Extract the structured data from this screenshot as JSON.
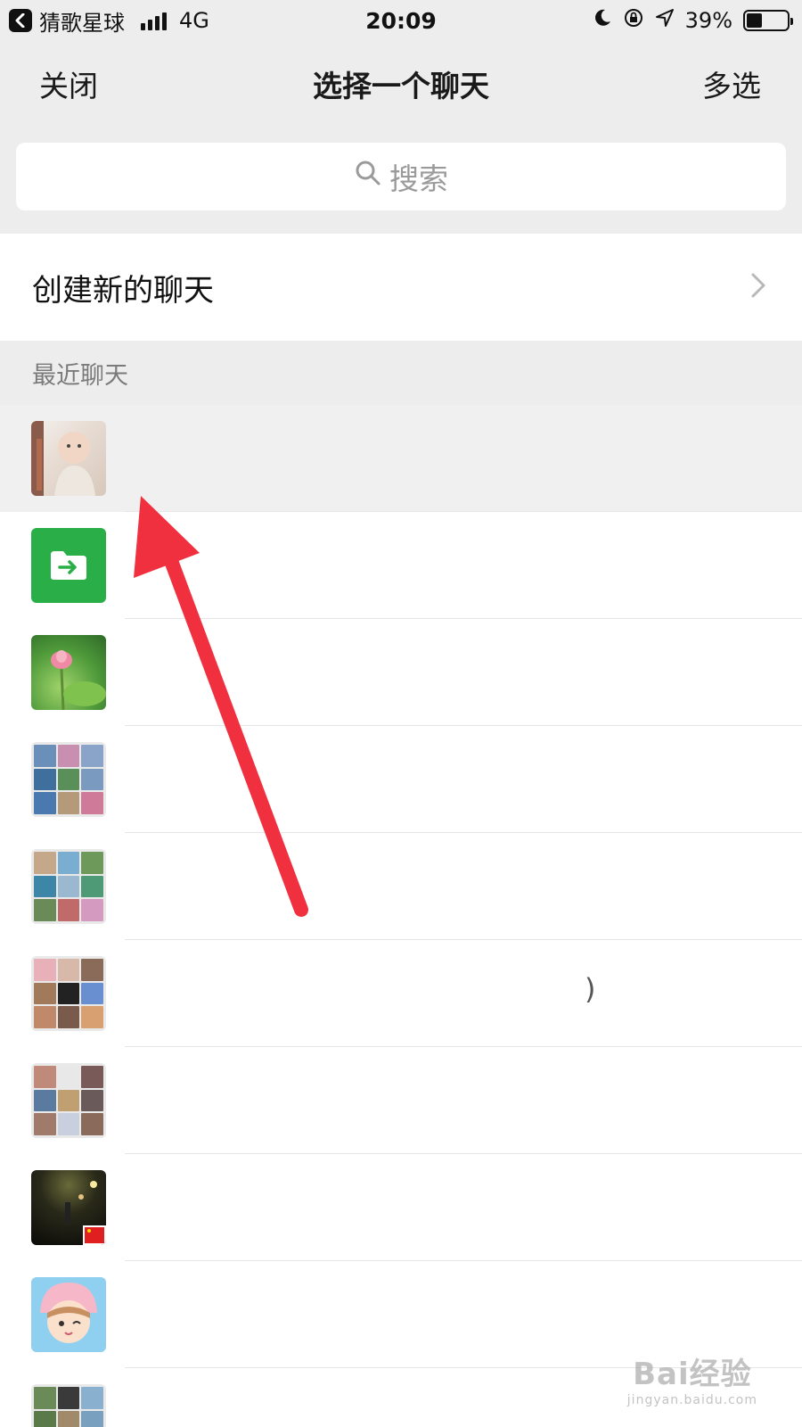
{
  "statusbar": {
    "carrier": "猜歌星球",
    "network": "4G",
    "time": "20:09",
    "battery": "39%",
    "battery_level": 0.39
  },
  "navbar": {
    "close_label": "关闭",
    "title": "选择一个聊天",
    "multi_label": "多选"
  },
  "search": {
    "placeholder": "搜索"
  },
  "new_chat": {
    "label": "创建新的聊天"
  },
  "section": {
    "label": "最近聊天"
  },
  "list": {
    "paren_text": ")"
  },
  "watermark": {
    "brand": "Bai经验",
    "url": "jingyan.baidu.com"
  },
  "colors": {
    "accent_green": "#2aae48",
    "arrow_red": "#f0303f"
  }
}
